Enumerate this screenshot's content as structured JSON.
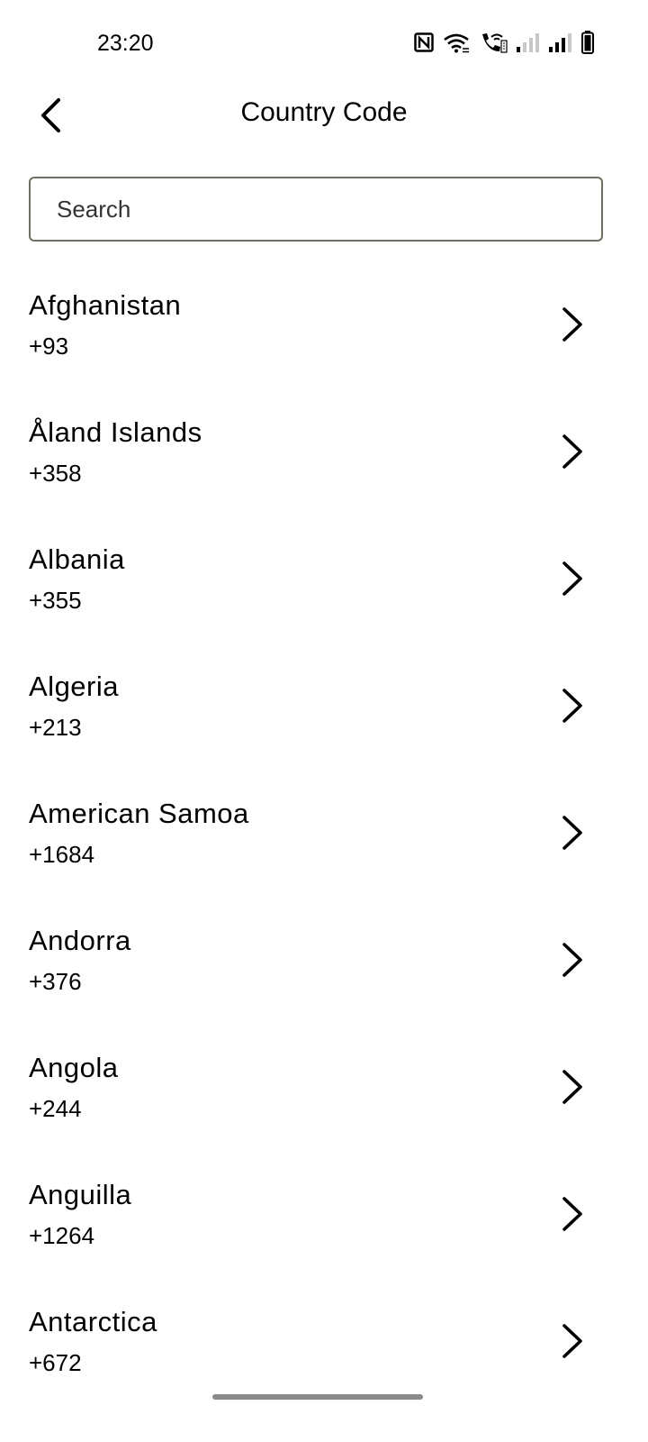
{
  "status_bar": {
    "time": "23:20",
    "icons": [
      "nfc-icon",
      "wifi-icon",
      "wifi-calling-icon",
      "signal-icon",
      "signal-icon",
      "battery-icon"
    ]
  },
  "header": {
    "title": "Country Code",
    "back_icon": "chevron-left-icon"
  },
  "search": {
    "placeholder": "Search",
    "value": ""
  },
  "countries": [
    {
      "name": "Afghanistan",
      "code": "+93"
    },
    {
      "name": "Åland Islands",
      "code": "+358"
    },
    {
      "name": "Albania",
      "code": "+355"
    },
    {
      "name": "Algeria",
      "code": "+213"
    },
    {
      "name": "American Samoa",
      "code": "+1684"
    },
    {
      "name": "Andorra",
      "code": "+376"
    },
    {
      "name": "Angola",
      "code": "+244"
    },
    {
      "name": "Anguilla",
      "code": "+1264"
    },
    {
      "name": "Antarctica",
      "code": "+672"
    }
  ],
  "colors": {
    "background": "#ffffff",
    "text": "#000000",
    "search_border": "#6e6e62",
    "home_indicator": "#8a8a8a"
  }
}
